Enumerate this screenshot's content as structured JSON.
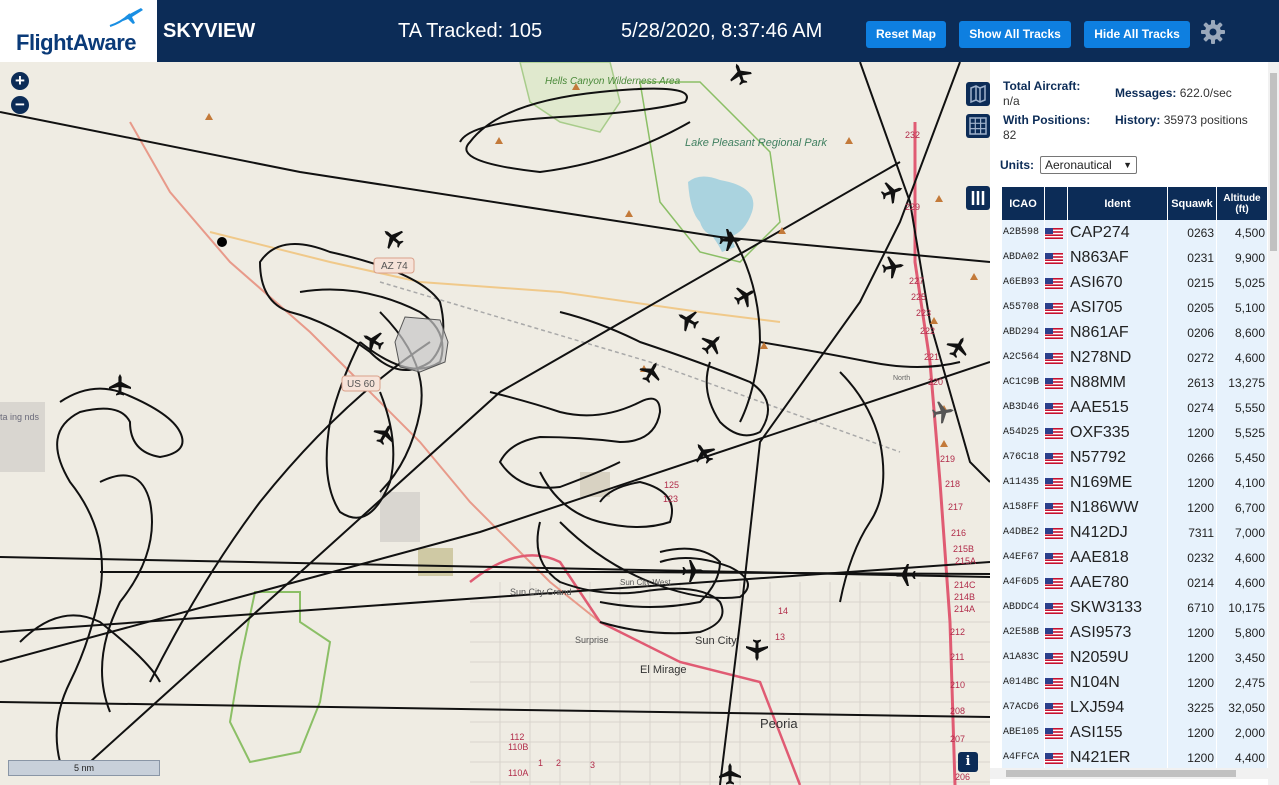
{
  "brand": {
    "logo_text": "FlightAware",
    "app_name": "SKYVIEW"
  },
  "header": {
    "tracked": "TA Tracked: 105",
    "datetime": "5/28/2020, 8:37:46 AM",
    "reset_label": "Reset Map",
    "show_tracks_label": "Show All Tracks",
    "hide_tracks_label": "Hide All Tracks",
    "settings_icon": "gear-icon"
  },
  "map": {
    "labels": {
      "hells_canyon": "Hells Canyon Wilderness Area",
      "lake_pleasant": "Lake Pleasant Regional Park",
      "az74": "AZ 74",
      "us60": "US 60",
      "sun_city_grand": "Sun City Grand",
      "surprise": "Surprise",
      "el_mirage": "El Mirage",
      "sun_city": "Sun City",
      "peoria": "Peoria",
      "sun_city_west": "Sun City West",
      "north": "North",
      "left_edge": "ta ing nds"
    },
    "highway_marks": [
      "232",
      "229",
      "227",
      "225",
      "223",
      "222",
      "221",
      "220",
      "219",
      "218",
      "217",
      "216",
      "215B",
      "215A",
      "214C",
      "214B",
      "214A",
      "212",
      "211",
      "210",
      "208",
      "207",
      "206",
      "125",
      "123",
      "112",
      "110B",
      "110A",
      "14",
      "13",
      "3",
      "2",
      "1"
    ],
    "scale_label": "5 nm",
    "zoom_in_icon": "plus-icon",
    "zoom_out_icon": "minus-icon",
    "basemap_icon": "map-icon",
    "grid_icon": "grid-icon",
    "columns_icon": "columns-icon",
    "info_icon": "info-icon",
    "info_text": "i",
    "colors": {
      "track": "#111111",
      "land": "#efece3",
      "water": "#aad3df",
      "park": "#cfe3b3",
      "highway": "#e89a8a",
      "boundary": "#8bbf66"
    }
  },
  "panel": {
    "total_aircraft_label": "Total Aircraft:",
    "total_aircraft_value": "n/a",
    "with_positions_label": "With Positions:",
    "with_positions_value": "82",
    "messages_label": "Messages:",
    "messages_value": "622.0/sec",
    "history_label": "History:",
    "history_value": "35973 positions",
    "units_label": "Units:",
    "units_value": "Aeronautical"
  },
  "table": {
    "headers": {
      "icao": "ICAO",
      "flag": "",
      "ident": "Ident",
      "squawk": "Squawk",
      "altitude": "Altitude (ft)"
    },
    "rows": [
      {
        "icao": "A2B598",
        "ident": "CAP274",
        "squawk": "0263",
        "altitude": "4,500"
      },
      {
        "icao": "ABDA02",
        "ident": "N863AF",
        "squawk": "0231",
        "altitude": "9,900"
      },
      {
        "icao": "A6EB93",
        "ident": "ASI670",
        "squawk": "0215",
        "altitude": "5,025"
      },
      {
        "icao": "A55708",
        "ident": "ASI705",
        "squawk": "0205",
        "altitude": "5,100"
      },
      {
        "icao": "ABD294",
        "ident": "N861AF",
        "squawk": "0206",
        "altitude": "8,600"
      },
      {
        "icao": "A2C564",
        "ident": "N278ND",
        "squawk": "0272",
        "altitude": "4,600"
      },
      {
        "icao": "AC1C9B",
        "ident": "N88MM",
        "squawk": "2613",
        "altitude": "13,275"
      },
      {
        "icao": "AB3D46",
        "ident": "AAE515",
        "squawk": "0274",
        "altitude": "5,550"
      },
      {
        "icao": "A54D25",
        "ident": "OXF335",
        "squawk": "1200",
        "altitude": "5,525"
      },
      {
        "icao": "A76C18",
        "ident": "N57792",
        "squawk": "0266",
        "altitude": "5,450"
      },
      {
        "icao": "A11435",
        "ident": "N169ME",
        "squawk": "1200",
        "altitude": "4,100"
      },
      {
        "icao": "A158FF",
        "ident": "N186WW",
        "squawk": "1200",
        "altitude": "6,700"
      },
      {
        "icao": "A4DBE2",
        "ident": "N412DJ",
        "squawk": "7311",
        "altitude": "7,000"
      },
      {
        "icao": "A4EF67",
        "ident": "AAE818",
        "squawk": "0232",
        "altitude": "4,600"
      },
      {
        "icao": "A4F6D5",
        "ident": "AAE780",
        "squawk": "0214",
        "altitude": "4,600"
      },
      {
        "icao": "ABDDC4",
        "ident": "SKW3133",
        "squawk": "6710",
        "altitude": "10,175"
      },
      {
        "icao": "A2E58B",
        "ident": "ASI9573",
        "squawk": "1200",
        "altitude": "5,800"
      },
      {
        "icao": "A1A83C",
        "ident": "N2059U",
        "squawk": "1200",
        "altitude": "3,450"
      },
      {
        "icao": "A014BC",
        "ident": "N104N",
        "squawk": "1200",
        "altitude": "2,475"
      },
      {
        "icao": "A7ACD6",
        "ident": "LXJ594",
        "squawk": "3225",
        "altitude": "32,050"
      },
      {
        "icao": "ABE105",
        "ident": "ASI155",
        "squawk": "1200",
        "altitude": "2,000"
      },
      {
        "icao": "A4FFCA",
        "ident": "N421ER",
        "squawk": "1200",
        "altitude": "4,400"
      }
    ]
  }
}
